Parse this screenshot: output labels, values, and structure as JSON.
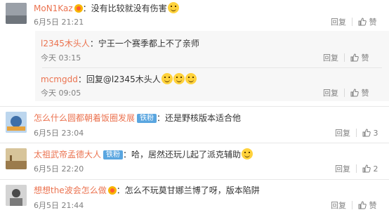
{
  "comments": [
    {
      "name": "MoN1Kaz",
      "badge": "vip",
      "fan": "",
      "text": "：没有比较就没有伤害",
      "emoji_count": 1,
      "time": "6月5日 21:21",
      "reply": "回复",
      "likes": "",
      "like_label": "赞"
    },
    {
      "name": "怎么什么圆都朝着饭圈发展",
      "badge": "",
      "fan": "铁粉",
      "text": "：还是野核版本适合他",
      "emoji_count": 0,
      "time": "6月5日 23:04",
      "reply": "回复",
      "likes": "3",
      "like_label": "赞"
    },
    {
      "name": "太祖武帝孟德大人",
      "badge": "",
      "fan": "铁粉",
      "text": "：哈，居然还玩儿起了派克辅助",
      "emoji_count": 1,
      "time": "6月5日 22:20",
      "reply": "回复",
      "likes": "2",
      "like_label": "赞"
    },
    {
      "name": "想想the波会怎么做",
      "badge": "vip",
      "fan": "",
      "text": "：怎么不玩莫甘娜兰博了呀，版本陷阱",
      "emoji_count": 0,
      "time": "6月5日 21:44",
      "reply": "回复",
      "likes": "",
      "like_label": "赞"
    }
  ],
  "replies": [
    {
      "name": "l2345木头人",
      "text": "：宁王一个赛季都上不了亲师",
      "time": "今天 03:15",
      "reply": "回复",
      "like_label": "赞"
    },
    {
      "name": "mcmgdd",
      "text": "：回复@l2345木头人",
      "emoji_count": 3,
      "time": "今天 09:05",
      "reply": "回复",
      "like_label": "赞"
    }
  ]
}
